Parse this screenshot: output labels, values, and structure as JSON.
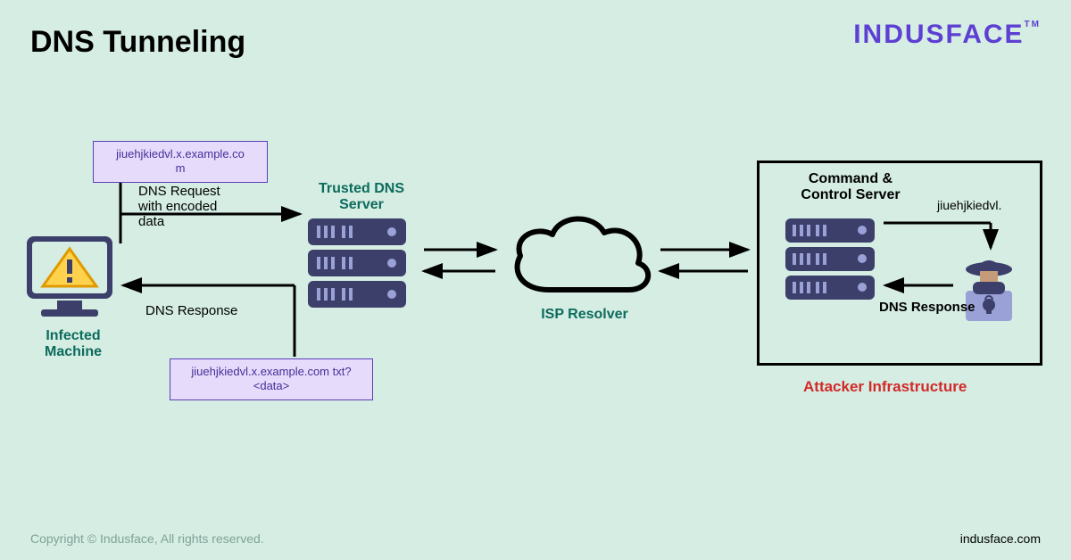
{
  "title": "DNS Tunneling",
  "brand": "INDUSFACE",
  "brand_tm": "TM",
  "footer_left": "Copyright © Indusface, All rights reserved.",
  "footer_right": "indusface.com",
  "nodes": {
    "infected": "Infected\nMachine",
    "trusted_dns": "Trusted DNS\nServer",
    "isp": "ISP Resolver",
    "cc": "Command &\nControl Server",
    "attacker_infra": "Attacker Infrastructure"
  },
  "edges": {
    "dns_request": "DNS Request\nwith encoded\ndata",
    "dns_response_left": "DNS Response",
    "encoded_subdomain": "jiuehjkiedvl.",
    "dns_response_right": "DNS Response"
  },
  "boxes": {
    "top": "jiuehjkiedvl.x.example.co\nm",
    "bottom": "jiuehjkiedvl.x.example.com txt?\n<data>"
  }
}
